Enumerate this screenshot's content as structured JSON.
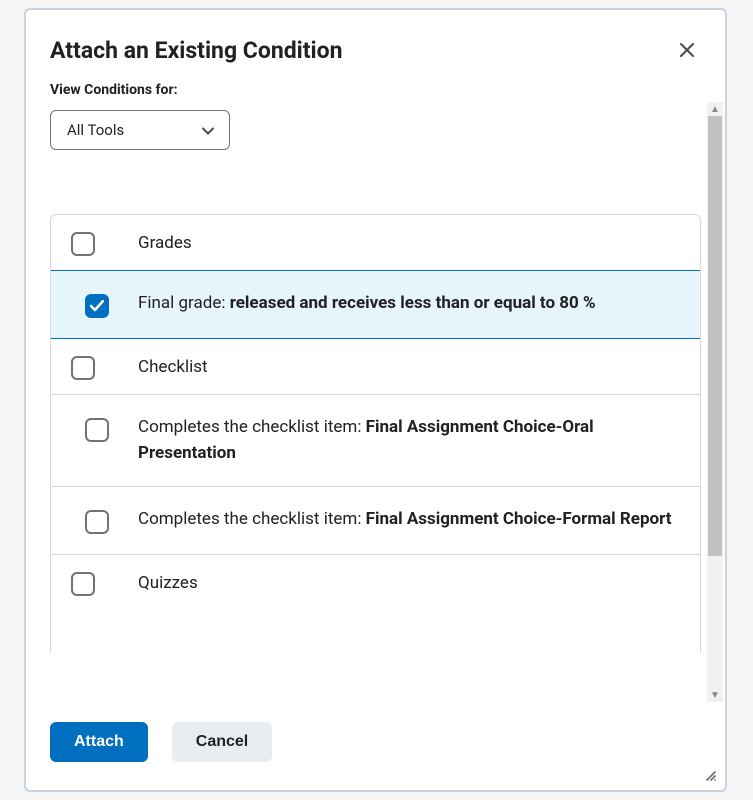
{
  "dialog": {
    "title": "Attach an Existing Condition"
  },
  "filter": {
    "label": "View Conditions for:",
    "selected": "All Tools"
  },
  "groups": {
    "grades": {
      "label": "Grades"
    },
    "checklist": {
      "label": "Checklist"
    },
    "quizzes": {
      "label": "Quizzes"
    }
  },
  "items": {
    "finalGrade": {
      "prefix": "Final grade: ",
      "bold": "released and receives less than or equal to 80 %",
      "checked": true
    },
    "checklistOral": {
      "prefix": "Completes the checklist item: ",
      "bold": "Final Assignment Choice-Oral Presentation",
      "checked": false
    },
    "checklistFormal": {
      "prefix": "Completes the checklist item: ",
      "bold": "Final Assignment Choice-Formal Report",
      "checked": false
    }
  },
  "footer": {
    "attach": "Attach",
    "cancel": "Cancel"
  }
}
